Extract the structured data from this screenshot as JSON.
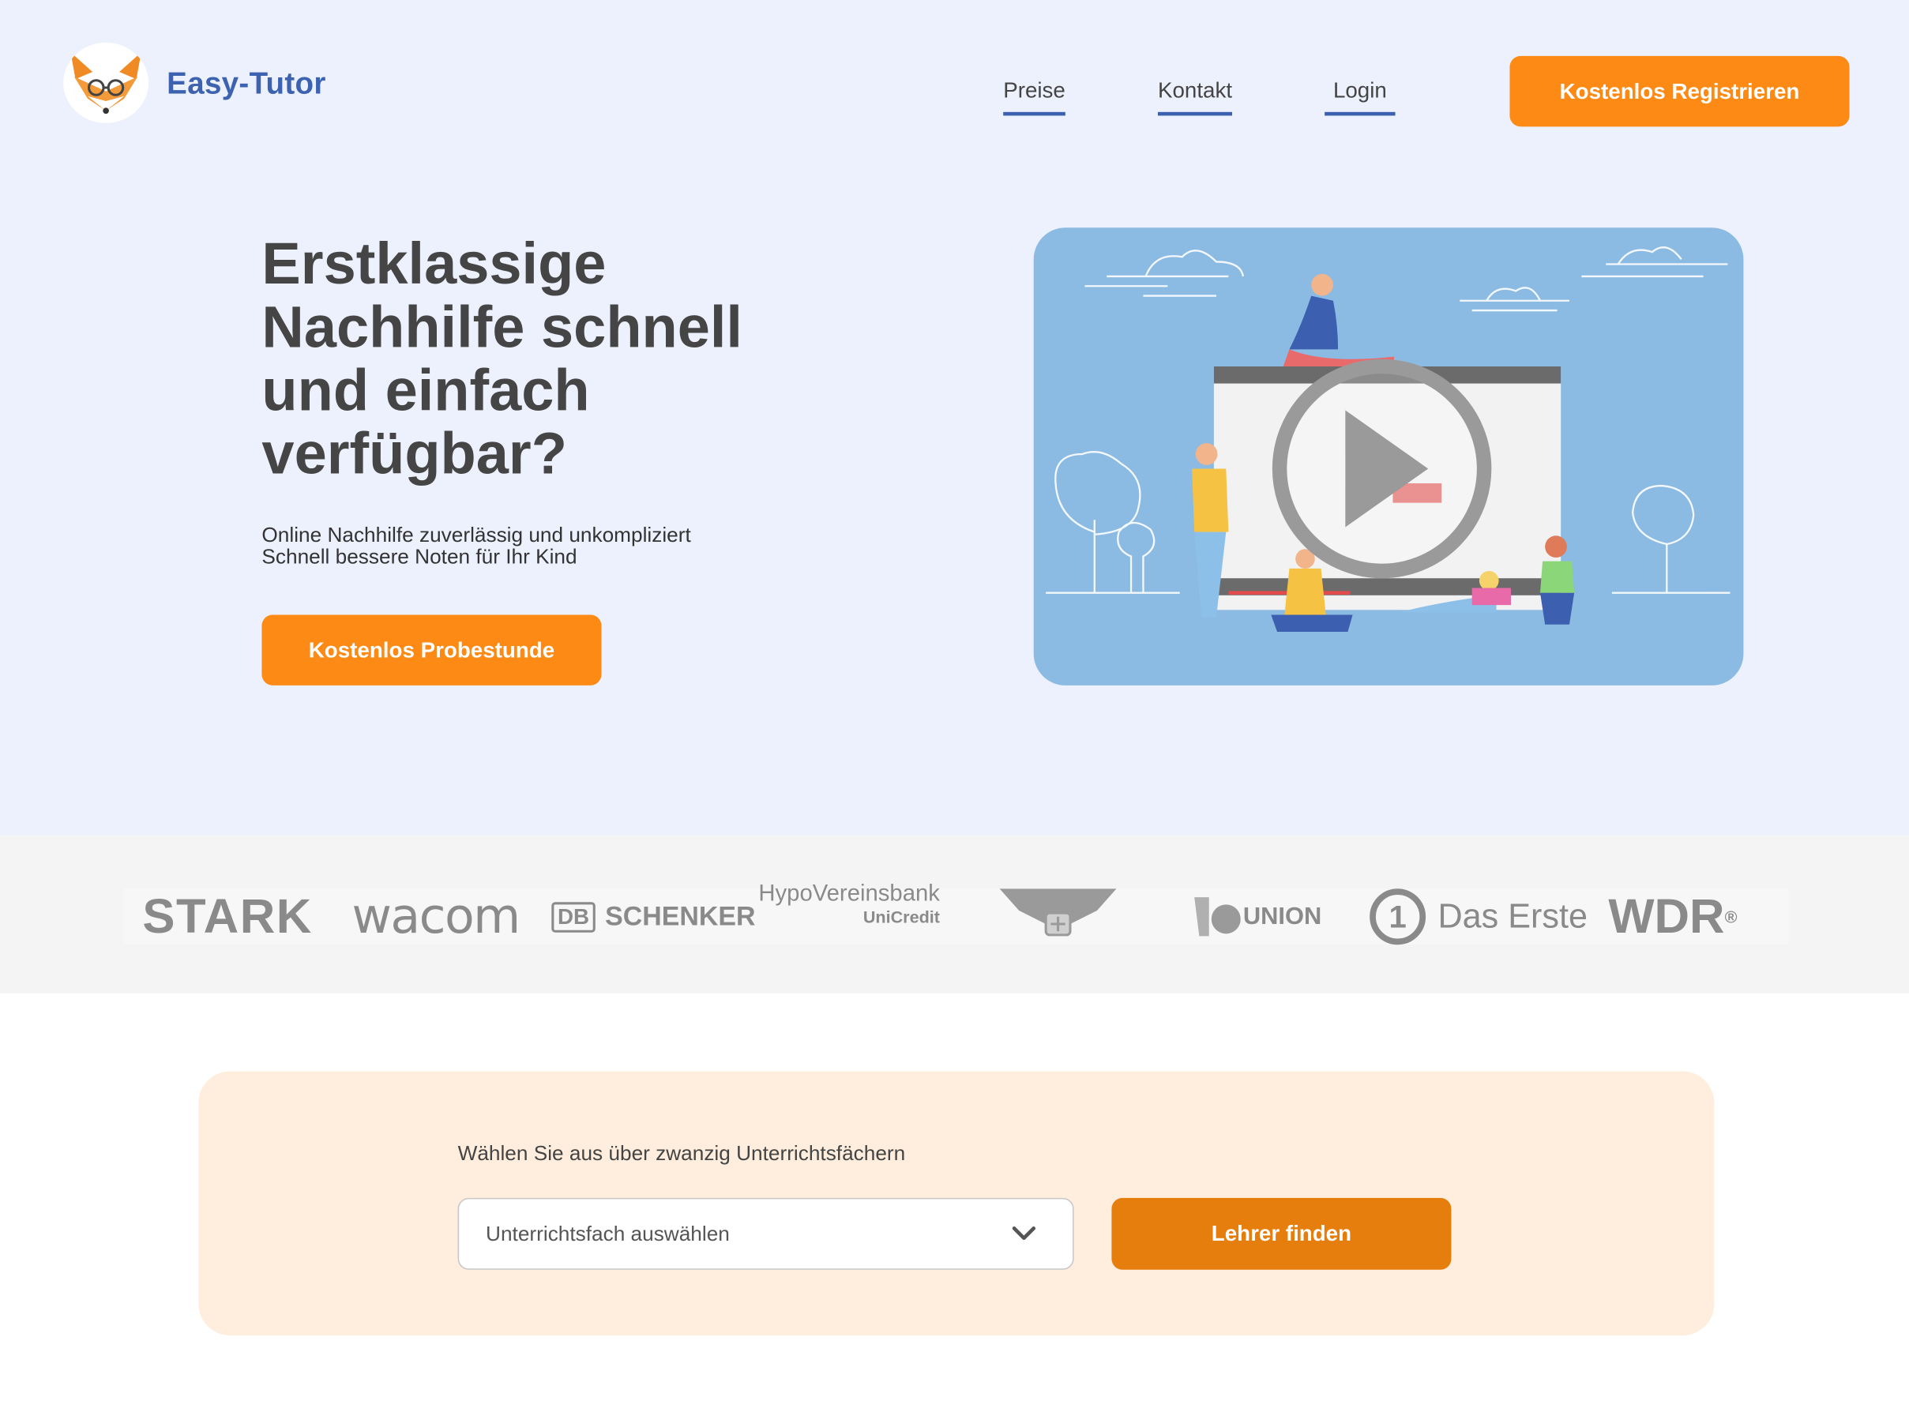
{
  "header": {
    "brand": "Easy-Tutor",
    "nav": [
      "Preise",
      "Kontakt",
      "Login"
    ],
    "register_label": "Kostenlos Registrieren"
  },
  "hero": {
    "headline_lines": [
      "Erstklassige",
      "Nachhilfe schnell",
      "und einfach",
      "verfügbar?"
    ],
    "sub_lines": [
      "Online Nachhilfe zuverlässig und unkompliziert",
      "Schnell bessere Noten für Ihr Kind"
    ],
    "cta_label": "Kostenlos Probestunde"
  },
  "logos": {
    "stark": "STARK",
    "wacom": "wacom",
    "db_box": "DB",
    "db_text": "SCHENKER",
    "hypo_main": "HypoVereinsbank",
    "hypo_sub": "UniCredit",
    "union": "UNION",
    "erste_num": "1",
    "erste_text": "Das Erste",
    "wdr": "WDR",
    "wdr_mark": "®"
  },
  "search": {
    "label": "Wählen Sie aus über zwanzig Unterrichtsfächern",
    "select_value": "Unterrichtsfach auswählen",
    "button_label": "Lehrer finden"
  },
  "colors": {
    "hero_bg": "#ecf1fd",
    "brand_blue": "#3d62b0",
    "orange": "#fe8a16",
    "orange_dark": "#e57e0c",
    "search_bg": "#ffeedd",
    "video_bg": "#8bbbe3"
  },
  "icons": {
    "logo": "fox-logo-icon",
    "video": "play-icon",
    "select": "chevron-down-icon"
  }
}
